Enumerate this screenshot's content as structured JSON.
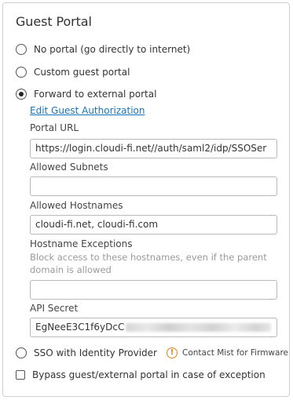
{
  "panel": {
    "title": "Guest Portal"
  },
  "options": {
    "no_portal": "No portal (go directly to internet)",
    "custom_portal": "Custom guest portal",
    "forward_external": "Forward to external portal",
    "sso": "SSO with Identity Provider",
    "bypass": "Bypass guest/external portal in case of exception"
  },
  "selected_option": "forward_external",
  "edit_link": "Edit Guest Authorization",
  "fields": {
    "portal_url_label": "Portal URL",
    "portal_url_value": "https://login.cloudi-fi.net//auth/saml2/idp/SSOSer",
    "allowed_subnets_label": "Allowed Subnets",
    "allowed_subnets_value": "",
    "allowed_hostnames_label": "Allowed Hostnames",
    "allowed_hostnames_value": "cloudi-fi.net, cloudi-fi.com",
    "hostname_exceptions_label": "Hostname Exceptions",
    "hostname_exceptions_hint": "Block access to these hostnames, even if the parent domain is allowed",
    "hostname_exceptions_value": "",
    "api_secret_label": "API Secret",
    "api_secret_visible": "EgNeeE3C1f6yDcC"
  },
  "sso_notice": {
    "icon": "warning-icon",
    "text": "Contact Mist for Firmware",
    "color": "#e0821e"
  },
  "colors": {
    "link": "#1a73b5",
    "border": "#cfcfcf"
  }
}
